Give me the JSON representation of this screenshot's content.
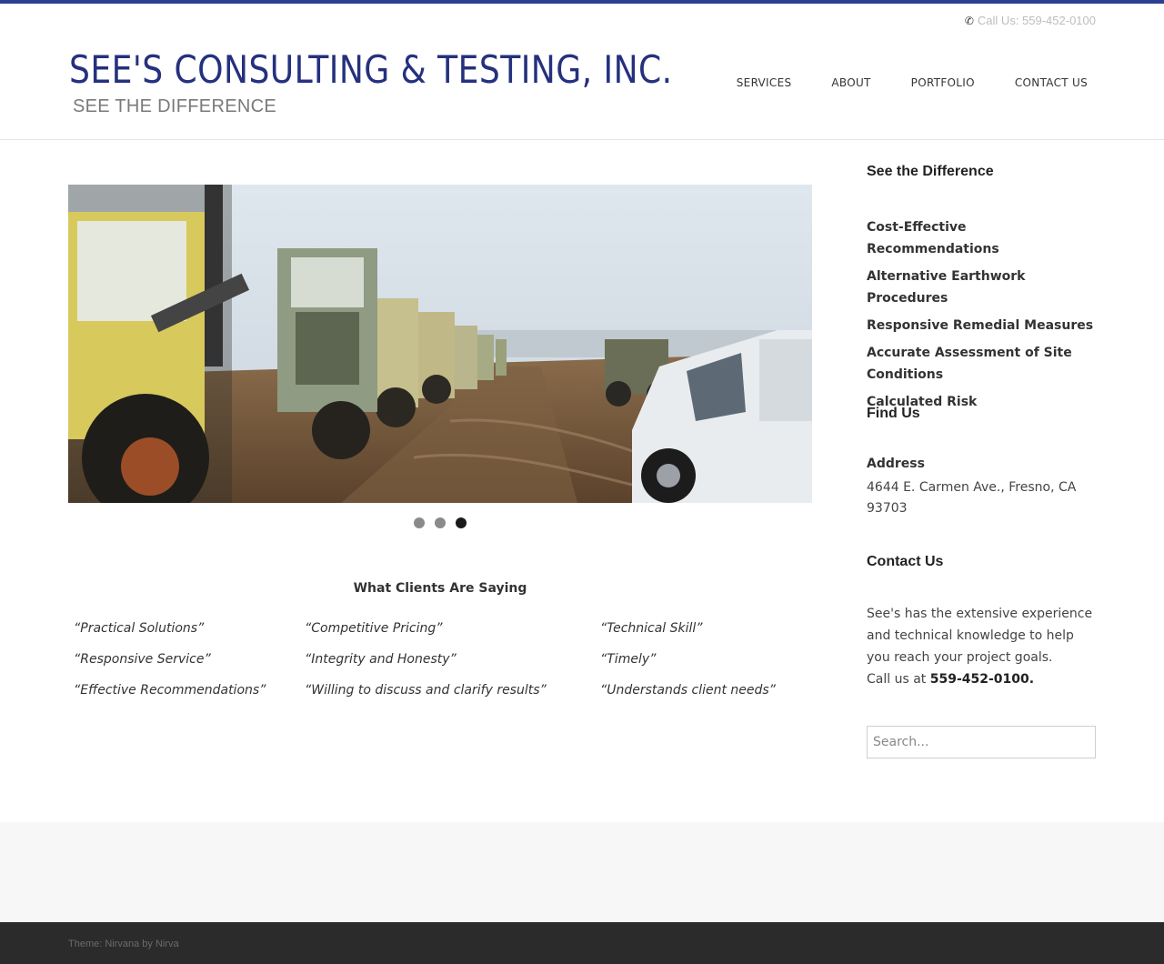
{
  "header": {
    "call_us": "Call Us: 559-452-0100",
    "logo_title": "SEE'S CONSULTING & TESTING, INC.",
    "logo_tagline": "SEE THE DIFFERENCE",
    "nav": [
      "SERVICES",
      "ABOUT",
      "PORTFOLIO",
      "CONTACT US"
    ]
  },
  "slider": {
    "dots": 3,
    "active_dot": 3
  },
  "clients": {
    "title": "What Clients Are Saying",
    "quotes": [
      [
        "“Practical Solutions”",
        "“Competitive Pricing”",
        "“Technical Skill”"
      ],
      [
        "“Responsive Service”",
        "“Integrity and Honesty”",
        "“Timely”"
      ],
      [
        "“Effective Recommendations”",
        "“Willing to discuss and clarify results”",
        "“Understands client needs”"
      ]
    ]
  },
  "sidebar": {
    "difference_title": "See the Difference",
    "difference_items": [
      "Cost-Effective Recommendations",
      "Alternative Earthwork Procedures",
      "Responsive Remedial Measures",
      "Accurate Assessment of Site Conditions",
      "Calculated Risk"
    ],
    "find_title": "Find Us",
    "address_label": "Address",
    "address_text": "4644 E. Carmen Ave., Fresno, CA 93703",
    "contact_title": "Contact Us",
    "contact_text": "See's has the extensive experience and technical knowledge to help you reach your project goals.",
    "contact_call_prefix": "Call us at ",
    "contact_phone": "559-452-0100.",
    "search_placeholder": "Search..."
  },
  "footer": {
    "text": "Theme: Nirvana by Nirva"
  }
}
